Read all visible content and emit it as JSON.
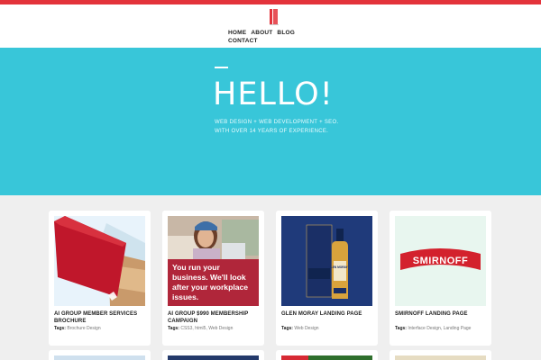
{
  "colors": {
    "brand": "#e3333b",
    "hero": "#38c6d9",
    "background": "#efefef"
  },
  "nav": {
    "items": [
      "HOME",
      "ABOUT",
      "BLOG",
      "CONTACT"
    ]
  },
  "hero": {
    "title": "HELLO!",
    "subtitle_line1": "WEB DESIGN + WEB DEVELOPMENT + SEO.",
    "subtitle_line2": "WITH OVER 14 YEARS OF EXPERIENCE."
  },
  "tags_label": "Tags:",
  "cards": [
    {
      "title": "AI GROUP MEMBER SERVICES BROCHURE",
      "tags": [
        "Brochure Design"
      ]
    },
    {
      "title": "AI GROUP $990 MEMBERSHIP CAMPAIGN",
      "tags": [
        "CSS3",
        "html5",
        "Web Design"
      ],
      "image_text": "You run your business. We'll look after your workplace issues."
    },
    {
      "title": "GLEN MORAY LANDING PAGE",
      "tags": [
        "Web Design"
      ],
      "image_text": "GLEN MORAY"
    },
    {
      "title": "SMIRNOFF LANDING PAGE",
      "tags": [
        "Interface Design",
        "Landing Page"
      ],
      "image_text": "SMIRNOFF"
    }
  ]
}
